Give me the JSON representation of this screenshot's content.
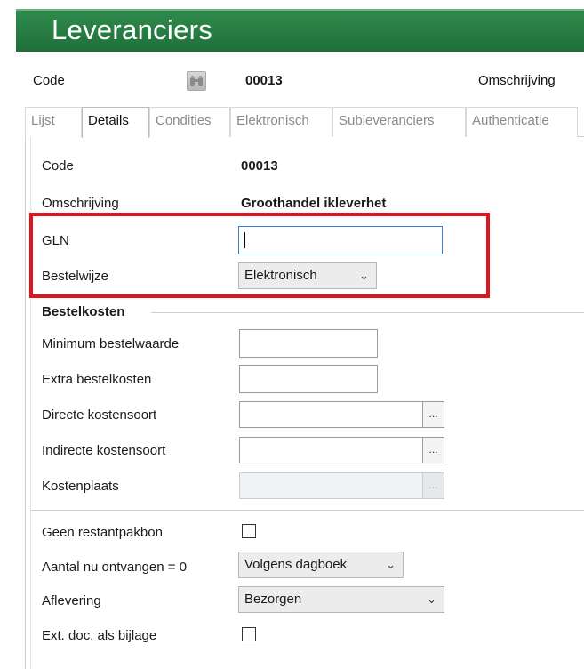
{
  "window": {
    "title": "Leveranciers"
  },
  "header": {
    "code_label": "Code",
    "code_value": "00013",
    "omschrijving_label": "Omschrijving"
  },
  "tabs": [
    {
      "label": "Lijst",
      "active": false
    },
    {
      "label": "Details",
      "active": true
    },
    {
      "label": "Condities",
      "active": false
    },
    {
      "label": "Elektronisch",
      "active": false
    },
    {
      "label": "Subleveranciers",
      "active": false
    },
    {
      "label": "Authenticatie",
      "active": false
    }
  ],
  "details": {
    "code_label": "Code",
    "code_value": "00013",
    "omschrijving_label": "Omschrijving",
    "omschrijving_value": "Groothandel ikleverhet",
    "gln_label": "GLN",
    "gln_value": "",
    "bestelwijze_label": "Bestelwijze",
    "bestelwijze_value": "Elektronisch"
  },
  "bestelkosten": {
    "section_title": "Bestelkosten",
    "minimum_label": "Minimum bestelwaarde",
    "minimum_value": "",
    "extra_label": "Extra bestelkosten",
    "extra_value": "",
    "directe_label": "Directe kostensoort",
    "directe_value": "",
    "indirecte_label": "Indirecte kostensoort",
    "indirecte_value": "",
    "kostenplaats_label": "Kostenplaats",
    "kostenplaats_value": "",
    "browse_glyph": "..."
  },
  "options": {
    "geen_restant_label": "Geen restantpakbon",
    "geen_restant_checked": false,
    "aantal_label": "Aantal nu ontvangen = 0",
    "aantal_value": "Volgens dagboek",
    "aflevering_label": "Aflevering",
    "aflevering_value": "Bezorgen",
    "extdoc_label": "Ext. doc. als bijlage",
    "extdoc_checked": false
  },
  "colors": {
    "title_bar": "#1f6f3a",
    "highlight": "#e0161e",
    "focus_border": "#3b7ed0"
  },
  "icons": {
    "chevron": "chevron-down-icon",
    "binoculars": "binoculars-icon"
  }
}
